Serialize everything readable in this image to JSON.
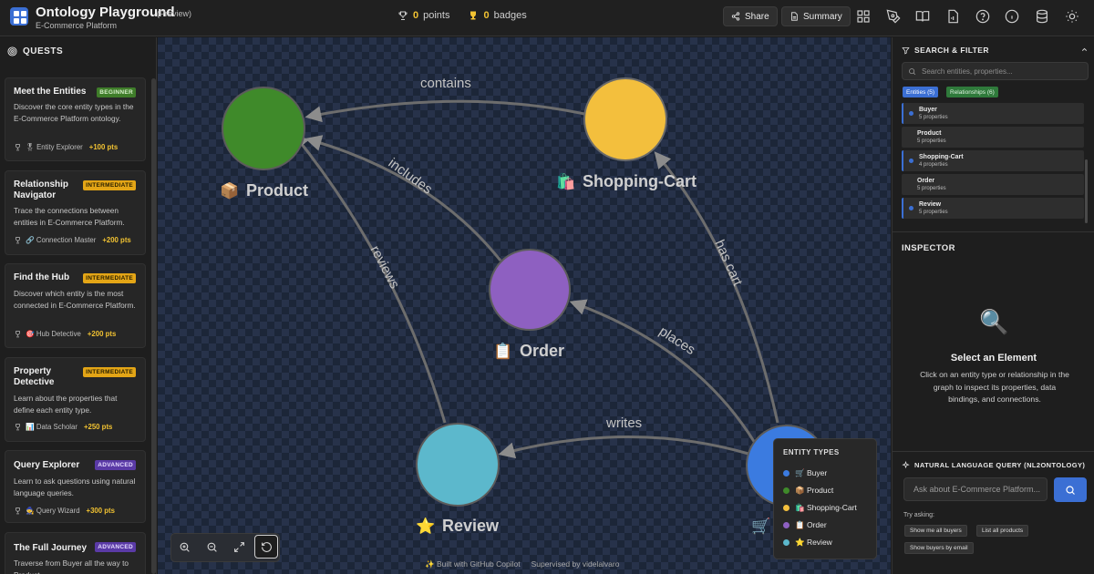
{
  "header": {
    "title": "Ontology Playground",
    "badge": "(Preview)",
    "subtitle": "E-Commerce Platform",
    "points_value": "0",
    "points_label": "points",
    "badges_value": "0",
    "badges_label": "badges",
    "share_label": "Share",
    "summary_label": "Summary",
    "icons": [
      "grid-icon",
      "pen-icon",
      "book-icon",
      "file-icon",
      "help-icon",
      "info-icon",
      "database-icon",
      "sun-icon"
    ]
  },
  "quests": {
    "heading": "QUESTS",
    "items": [
      {
        "title": "Meet the Entities",
        "level": "BEGINNER",
        "description": "Discover the core entity types in the E-Commerce Platform ontology.",
        "badge": "🎖 Entity Explorer",
        "points": "+100 pts"
      },
      {
        "title": "Relationship Navigator",
        "level": "INTERMEDIATE",
        "description": "Trace the connections between entities in E-Commerce Platform.",
        "badge": "🔗 Connection Master",
        "points": "+200 pts"
      },
      {
        "title": "Find the Hub",
        "level": "INTERMEDIATE",
        "description": "Discover which entity is the most connected in E-Commerce Platform.",
        "badge": "🎯 Hub Detective",
        "points": "+200 pts"
      },
      {
        "title": "Property Detective",
        "level": "INTERMEDIATE",
        "description": "Learn about the properties that define each entity type.",
        "badge": "📊 Data Scholar",
        "points": "+250 pts"
      },
      {
        "title": "Query Explorer",
        "level": "ADVANCED",
        "description": "Learn to ask questions using natural language queries.",
        "badge": "🧙 Query Wizard",
        "points": "+300 pts"
      },
      {
        "title": "The Full Journey",
        "level": "ADVANCED",
        "description": "Traverse from Buyer all the way to Product",
        "badge": "",
        "points": ""
      }
    ]
  },
  "graph": {
    "nodes": [
      {
        "id": "product",
        "label": "Product",
        "emoji": "📦",
        "color": "#3f8a2a"
      },
      {
        "id": "cart",
        "label": "Shopping-Cart",
        "emoji": "🛍️",
        "color": "#f3bf3d"
      },
      {
        "id": "order",
        "label": "Order",
        "emoji": "📋",
        "color": "#8e60c1"
      },
      {
        "id": "review",
        "label": "Review",
        "emoji": "⭐",
        "color": "#5cb8cc"
      },
      {
        "id": "buyer",
        "label": "",
        "emoji": "🛒",
        "color": "#3b7be0"
      }
    ],
    "edges": [
      {
        "label": "contains"
      },
      {
        "label": "includes"
      },
      {
        "label": "reviews"
      },
      {
        "label": "has cart"
      },
      {
        "label": "places"
      },
      {
        "label": "writes"
      }
    ]
  },
  "legend": {
    "title": "ENTITY TYPES",
    "items": [
      {
        "label": "🛒 Buyer",
        "color": "#3b7be0"
      },
      {
        "label": "📦 Product",
        "color": "#3f8a2a"
      },
      {
        "label": "🛍️ Shopping-Cart",
        "color": "#f3bf3d"
      },
      {
        "label": "📋 Order",
        "color": "#8e60c1"
      },
      {
        "label": "⭐ Review",
        "color": "#5cb8cc"
      }
    ]
  },
  "footer": {
    "built_with": "Built with GitHub Copilot",
    "supervised": "Supervised by videlalvaro"
  },
  "search": {
    "heading": "SEARCH & FILTER",
    "placeholder": "Search entities, properties...",
    "tab_entities": "Entities (5)",
    "tab_relationships": "Relationships (6)",
    "entities": [
      {
        "name": "Buyer",
        "props": "5 properties",
        "selected": true
      },
      {
        "name": "Product",
        "props": "5 properties",
        "selected": false
      },
      {
        "name": "Shopping-Cart",
        "props": "4 properties",
        "selected": true
      },
      {
        "name": "Order",
        "props": "5 properties",
        "selected": false
      },
      {
        "name": "Review",
        "props": "5 properties",
        "selected": true
      }
    ]
  },
  "inspector": {
    "heading": "INSPECTOR",
    "empty_title": "Select an Element",
    "empty_desc": "Click on an entity type or relationship in the graph to inspect its properties, data bindings, and connections."
  },
  "nlq": {
    "heading": "NATURAL LANGUAGE QUERY (NL2ONTOLOGY)",
    "placeholder": "Ask about E-Commerce Platform...",
    "try_label": "Try asking:",
    "suggestions": [
      "Show me all buyers",
      "List all products",
      "Show buyers by email"
    ]
  }
}
